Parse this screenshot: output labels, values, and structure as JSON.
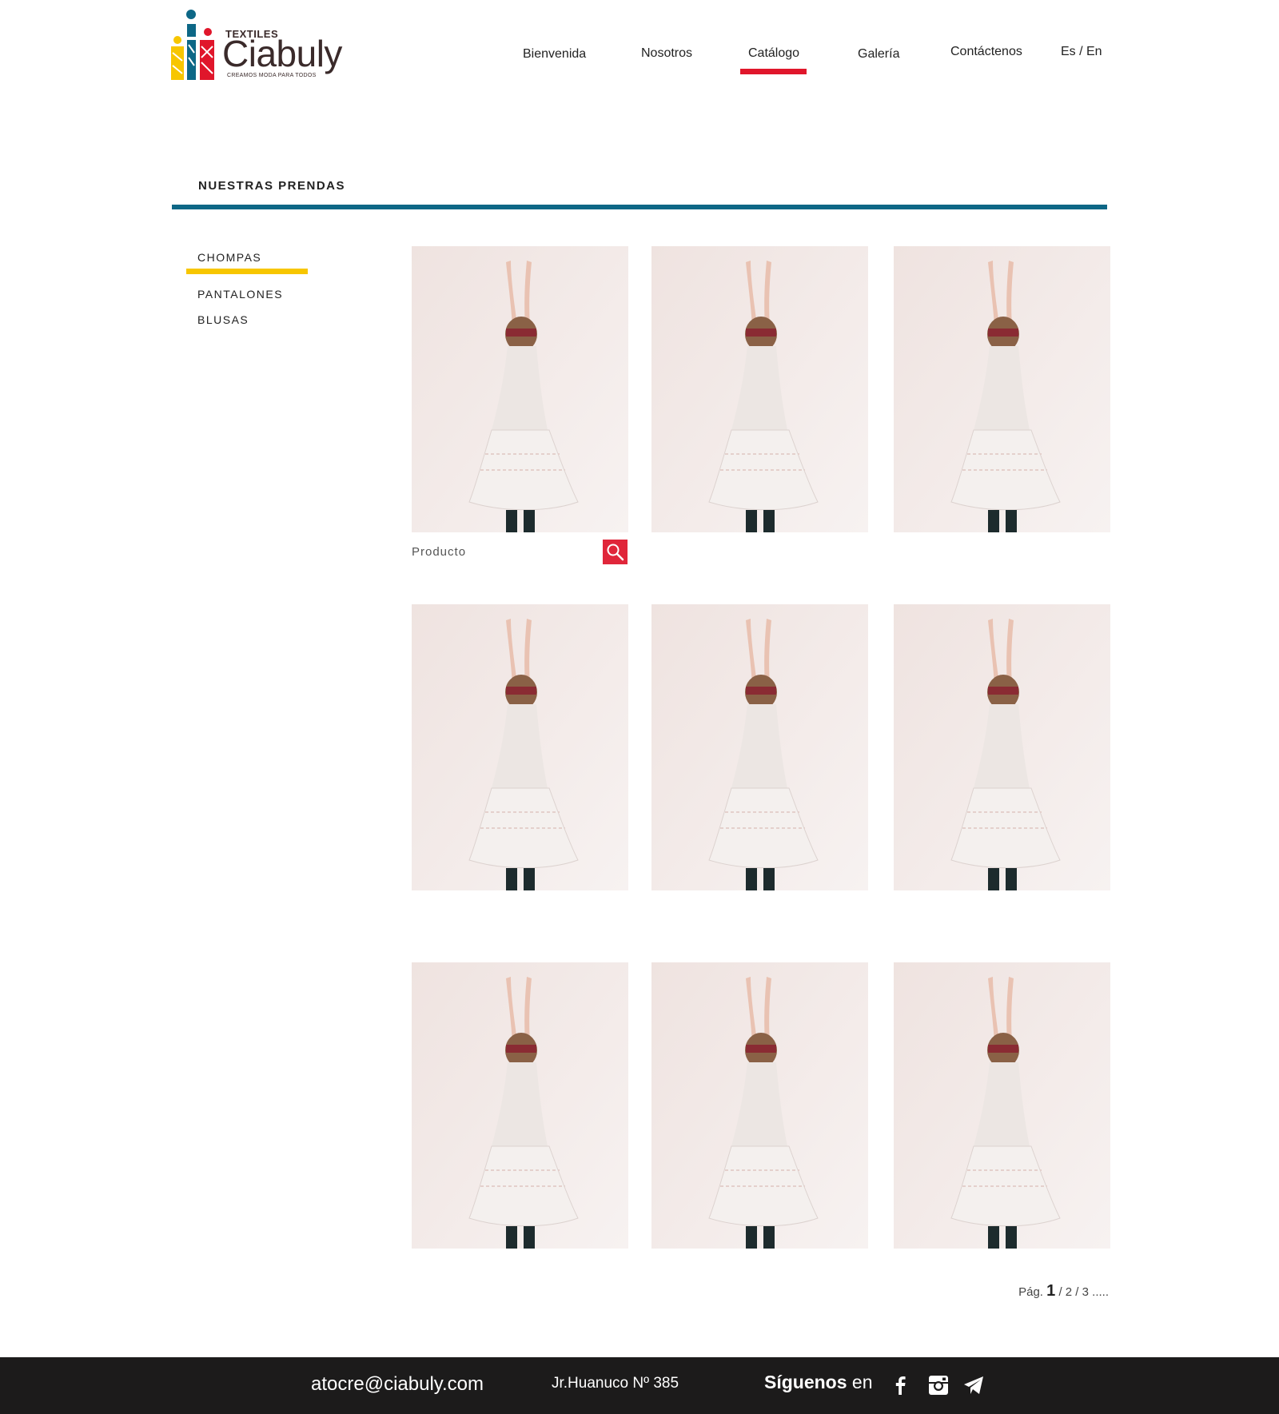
{
  "brand": {
    "small": "TEXTILES",
    "name": "Ciabuly",
    "tagline": "CREAMOS MODA PARA TODOS",
    "colors": {
      "blue": "#0d6786",
      "red": "#e0162b",
      "yellow": "#f7c600",
      "dark": "#3a2a2a"
    }
  },
  "nav": {
    "items": [
      {
        "label": "Bienvenida"
      },
      {
        "label": "Nosotros"
      },
      {
        "label": "Catálogo",
        "active": true
      },
      {
        "label": "Galería"
      },
      {
        "label": "Contáctenos"
      }
    ],
    "language": "Es / En"
  },
  "section": {
    "title": "NUESTRAS PRENDAS"
  },
  "categories": [
    {
      "label": "CHOMPAS",
      "active": true
    },
    {
      "label": "PANTALONES"
    },
    {
      "label": "BLUSAS"
    }
  ],
  "products": {
    "label": "Producto",
    "zoom_icon": "search-icon",
    "count": 9
  },
  "pagination": {
    "prefix": "Pág.",
    "current": "1",
    "pages": [
      "2",
      "3"
    ],
    "suffix": "....."
  },
  "footer": {
    "email": "atocre@ciabuly.com",
    "address": "Jr.Huanuco Nº 385",
    "follow_bold": "Síguenos",
    "follow_rest": " en",
    "social": [
      "facebook-icon",
      "instagram-icon",
      "telegram-icon"
    ]
  }
}
